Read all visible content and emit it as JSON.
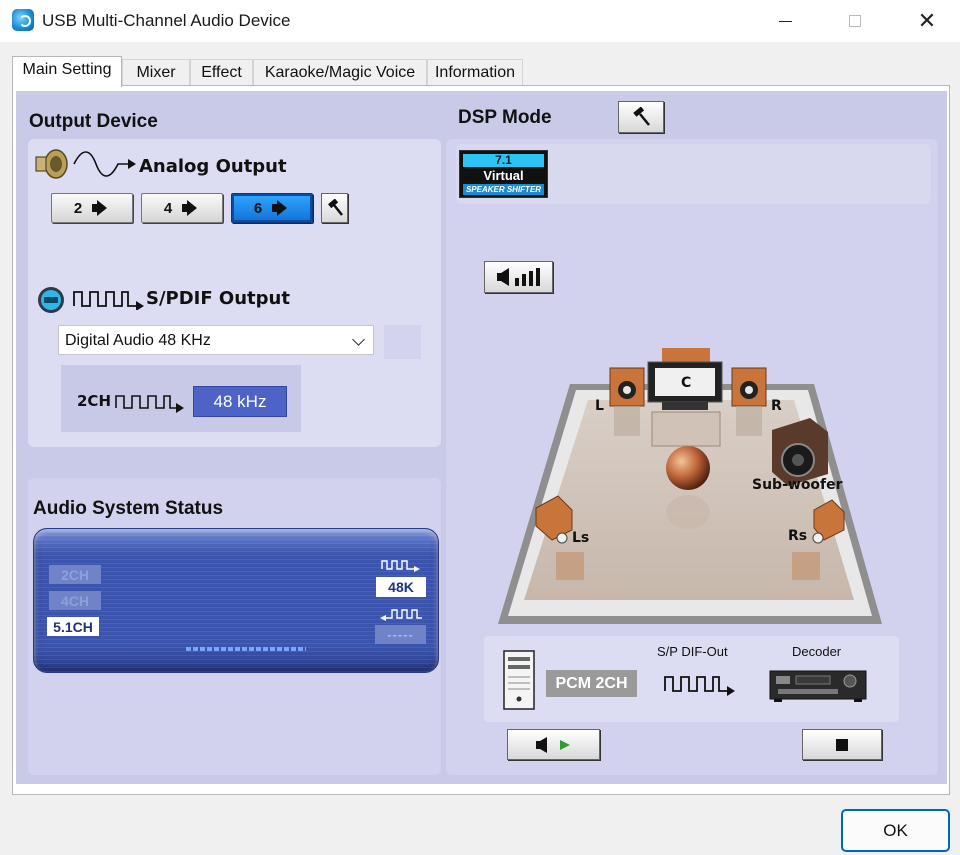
{
  "window": {
    "title": "USB Multi-Channel Audio Device",
    "controls": {
      "minimize": "—",
      "maximize": "☐",
      "close": "✕"
    }
  },
  "tabs": [
    {
      "label": "Main Setting",
      "active": true
    },
    {
      "label": "Mixer",
      "active": false
    },
    {
      "label": "Effect",
      "active": false
    },
    {
      "label": "Karaoke/Magic Voice",
      "active": false
    },
    {
      "label": "Information",
      "active": false
    }
  ],
  "output_device": {
    "heading": "Output Device",
    "analog": {
      "label": "Analog Output",
      "speaker_buttons": [
        {
          "label": "2",
          "selected": false
        },
        {
          "label": "4",
          "selected": false
        },
        {
          "label": "6",
          "selected": true
        }
      ]
    },
    "spdif": {
      "label": "S/PDIF Output",
      "dropdown_value": "Digital Audio 48 KHz",
      "channel_text": "2CH",
      "rate_value": "48 kHz"
    }
  },
  "status": {
    "heading": "Audio System Status",
    "channels": [
      {
        "label": "2CH",
        "active": false
      },
      {
        "label": "4CH",
        "active": false
      },
      {
        "label": "5.1CH",
        "active": true
      }
    ],
    "sample_rate": "48K",
    "input_rate": "-----"
  },
  "dsp": {
    "heading": "DSP Mode",
    "logo": {
      "top": "7.1",
      "middle": "Virtual",
      "bottom": "SPEAKER SHIFTER"
    },
    "speakers": {
      "center": "C",
      "left": "L",
      "right": "R",
      "subwoofer": "Sub-woofer",
      "left_surround": "Ls",
      "right_surround": "Rs"
    },
    "format": "PCM 2CH",
    "spdif_out_label": "S/P DIF-Out",
    "decoder_label": "Decoder"
  },
  "footer": {
    "ok_label": "OK"
  },
  "colors": {
    "panel_bg": "#c9cae8",
    "section_bg": "#dcdcf3",
    "accent_blue": "#4d63c6",
    "selected_button": "#1e8cf0",
    "ok_border": "#0067c0"
  }
}
